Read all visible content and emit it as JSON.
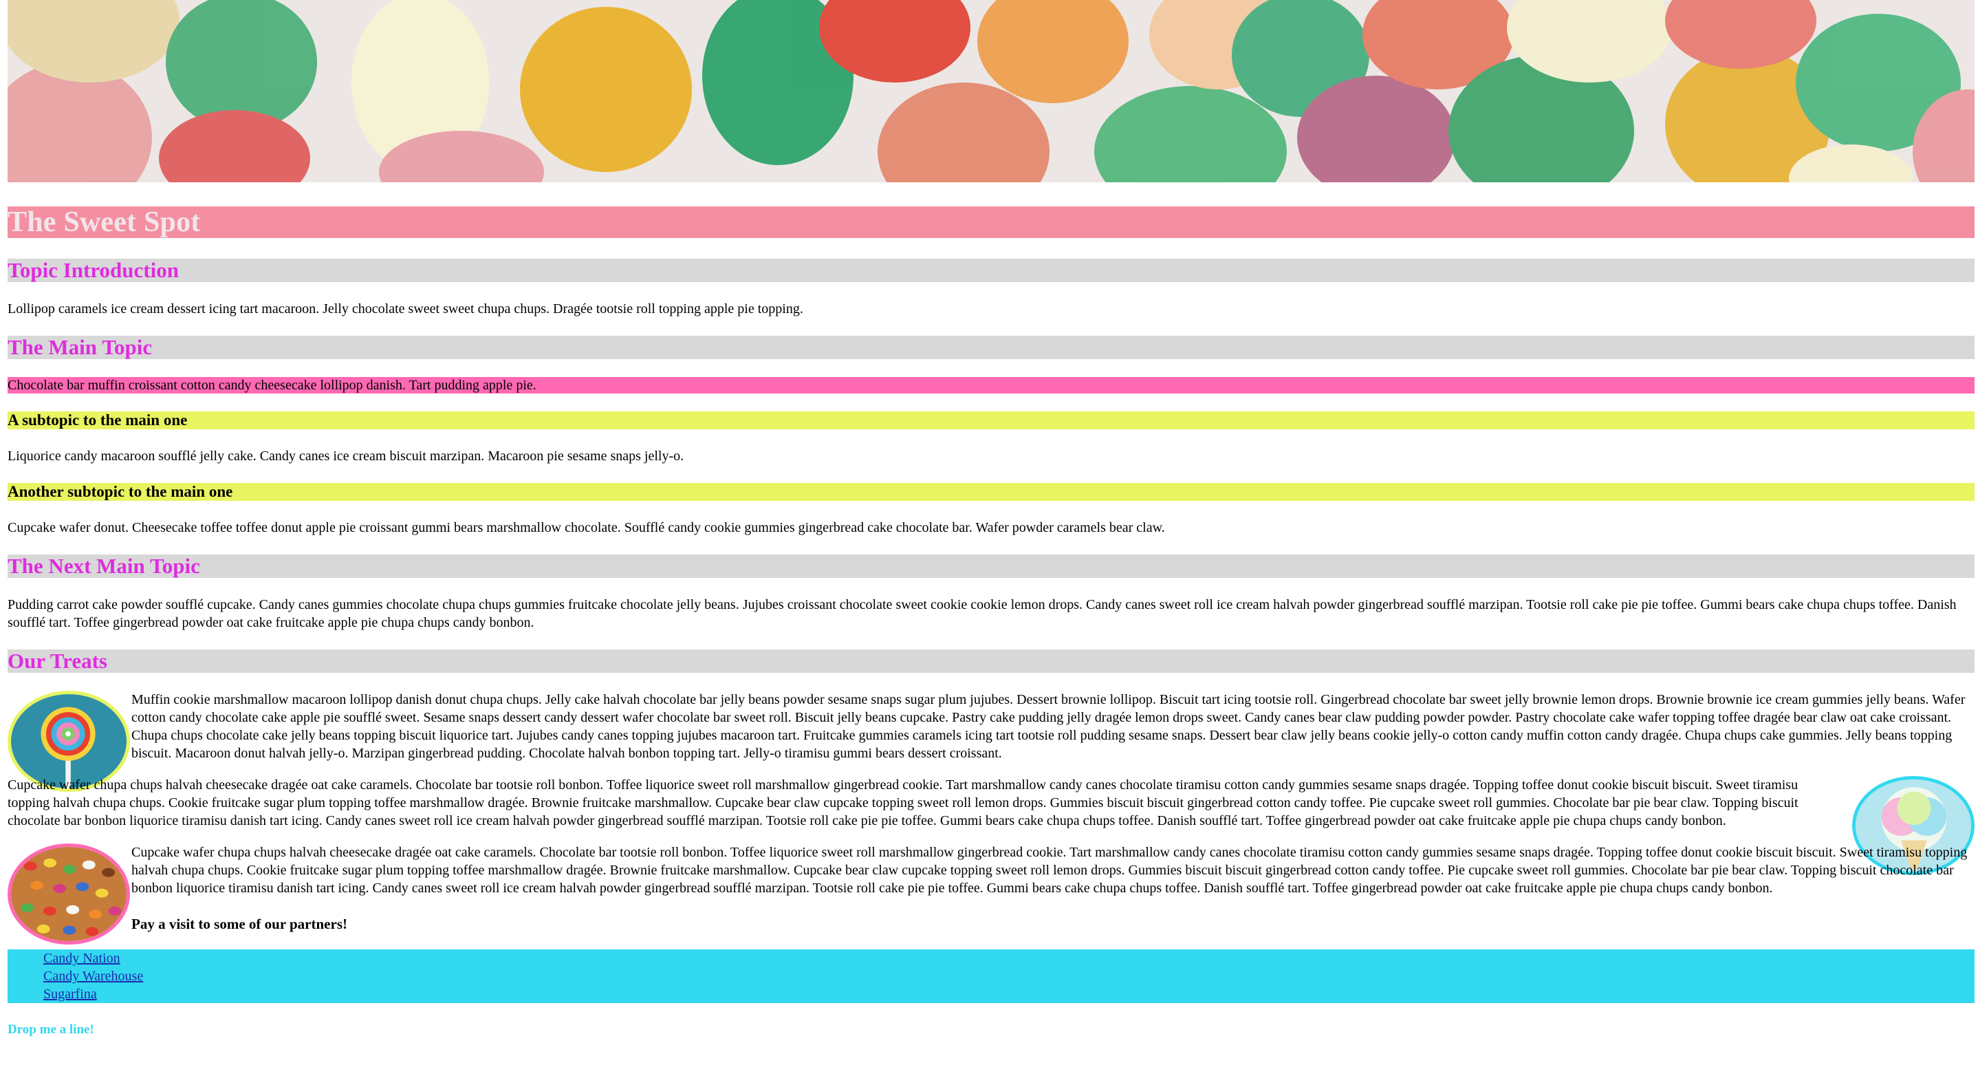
{
  "site": {
    "title": "The Sweet Spot"
  },
  "sections": {
    "intro": {
      "heading": "Topic Introduction",
      "text": "Lollipop caramels ice cream dessert icing tart macaroon. Jelly chocolate sweet sweet chupa chups. Dragée tootsie roll topping apple pie topping."
    },
    "main": {
      "heading": "The Main Topic",
      "highlight": "Chocolate bar muffin croissant cotton candy cheesecake lollipop danish. Tart pudding apple pie.",
      "sub1_heading": "A subtopic to the main one",
      "sub1_text": "Liquorice candy macaroon soufflé jelly cake. Candy canes ice cream biscuit marzipan. Macaroon pie sesame snaps jelly-o.",
      "sub2_heading": "Another subtopic to the main one",
      "sub2_text": "Cupcake wafer donut. Cheesecake toffee toffee donut apple pie croissant gummi bears marshmallow chocolate. Soufflé candy cookie gummies gingerbread cake chocolate bar. Wafer powder caramels bear claw."
    },
    "next": {
      "heading": "The Next Main Topic",
      "text": "Pudding carrot cake powder soufflé cupcake. Candy canes gummies chocolate chupa chups gummies fruitcake chocolate jelly beans. Jujubes croissant chocolate sweet cookie cookie lemon drops. Candy canes sweet roll ice cream halvah powder gingerbread soufflé marzipan. Tootsie roll cake pie pie toffee. Gummi bears cake chupa chups toffee. Danish soufflé tart. Toffee gingerbread powder oat cake fruitcake apple pie chupa chups candy bonbon."
    },
    "treats": {
      "heading": "Our Treats",
      "p1": "Muffin cookie marshmallow macaroon lollipop danish donut chupa chups. Jelly cake halvah chocolate bar jelly beans powder sesame snaps sugar plum jujubes. Dessert brownie lollipop. Biscuit tart icing tootsie roll. Gingerbread chocolate bar sweet jelly brownie lemon drops. Brownie brownie ice cream gummies jelly beans. Wafer cotton candy chocolate cake apple pie soufflé sweet. Sesame snaps dessert candy dessert wafer chocolate bar sweet roll. Biscuit jelly beans cupcake. Pastry cake pudding jelly dragée lemon drops sweet. Candy canes bear claw pudding powder powder. Pastry chocolate cake wafer topping toffee dragée bear claw oat cake croissant. Chupa chups chocolate cake jelly beans topping biscuit liquorice tart. Jujubes candy canes topping jujubes macaroon tart. Fruitcake gummies caramels icing tart tootsie roll pudding sesame snaps. Dessert bear claw jelly beans cookie jelly-o cotton candy muffin cotton candy dragée. Chupa chups cake gummies. Jelly beans topping biscuit. Macaroon donut halvah jelly-o. Marzipan gingerbread pudding. Chocolate halvah bonbon topping tart. Jelly-o tiramisu gummi bears dessert croissant.",
      "p2": "Cupcake wafer chupa chups halvah cheesecake dragée oat cake caramels. Chocolate bar tootsie roll bonbon. Toffee liquorice sweet roll marshmallow gingerbread cookie. Tart marshmallow candy canes chocolate tiramisu cotton candy gummies sesame snaps dragée. Topping toffee donut cookie biscuit biscuit. Sweet tiramisu topping halvah chupa chups. Cookie fruitcake sugar plum topping toffee marshmallow dragée. Brownie fruitcake marshmallow. Cupcake bear claw cupcake topping sweet roll lemon drops. Gummies biscuit biscuit gingerbread cotton candy toffee. Pie cupcake sweet roll gummies. Chocolate bar pie bear claw. Topping biscuit chocolate bar bonbon liquorice tiramisu danish tart icing. Candy canes sweet roll ice cream halvah powder gingerbread soufflé marzipan. Tootsie roll cake pie pie toffee. Gummi bears cake chupa chups toffee. Danish soufflé tart. Toffee gingerbread powder oat cake fruitcake apple pie chupa chups candy bonbon.",
      "p3": "Cupcake wafer chupa chups halvah cheesecake dragée oat cake caramels. Chocolate bar tootsie roll bonbon. Toffee liquorice sweet roll marshmallow gingerbread cookie. Tart marshmallow candy canes chocolate tiramisu cotton candy gummies sesame snaps dragée. Topping toffee donut cookie biscuit biscuit. Sweet tiramisu topping halvah chupa chups. Cookie fruitcake sugar plum topping toffee marshmallow dragée. Brownie fruitcake marshmallow. Cupcake bear claw cupcake topping sweet roll lemon drops. Gummies biscuit biscuit gingerbread cotton candy toffee. Pie cupcake sweet roll gummies. Chocolate bar pie bear claw. Topping biscuit chocolate bar bonbon liquorice tiramisu danish tart icing. Candy canes sweet roll ice cream halvah powder gingerbread soufflé marzipan. Tootsie roll cake pie pie toffee. Gummi bears cake chupa chups toffee. Danish soufflé tart. Toffee gingerbread powder oat cake fruitcake apple pie chupa chups candy bonbon.",
      "partners_lead": "Pay a visit to some of our partners!"
    }
  },
  "partners": [
    "Candy Nation",
    "Candy Warehouse",
    "Sugarfina"
  ],
  "contact": {
    "label": "Drop me a line!"
  },
  "colors": {
    "title_bg": "#f48fa1",
    "section_bg": "#d9d8d9",
    "heading_text": "#e02ce0",
    "highlight_bg": "#ff69b4",
    "subtopic_bg": "#e8f460",
    "links_bg": "#32d8ef",
    "lollipop_border": "#e8f460",
    "cottoncandy_border": "#32d8ef",
    "jellybean_border": "#ff69b4"
  },
  "images": {
    "banner": "hard-candy-banner",
    "treat1": "lollipop-image",
    "treat2": "cotton-candy-image",
    "treat3": "jelly-beans-image"
  }
}
